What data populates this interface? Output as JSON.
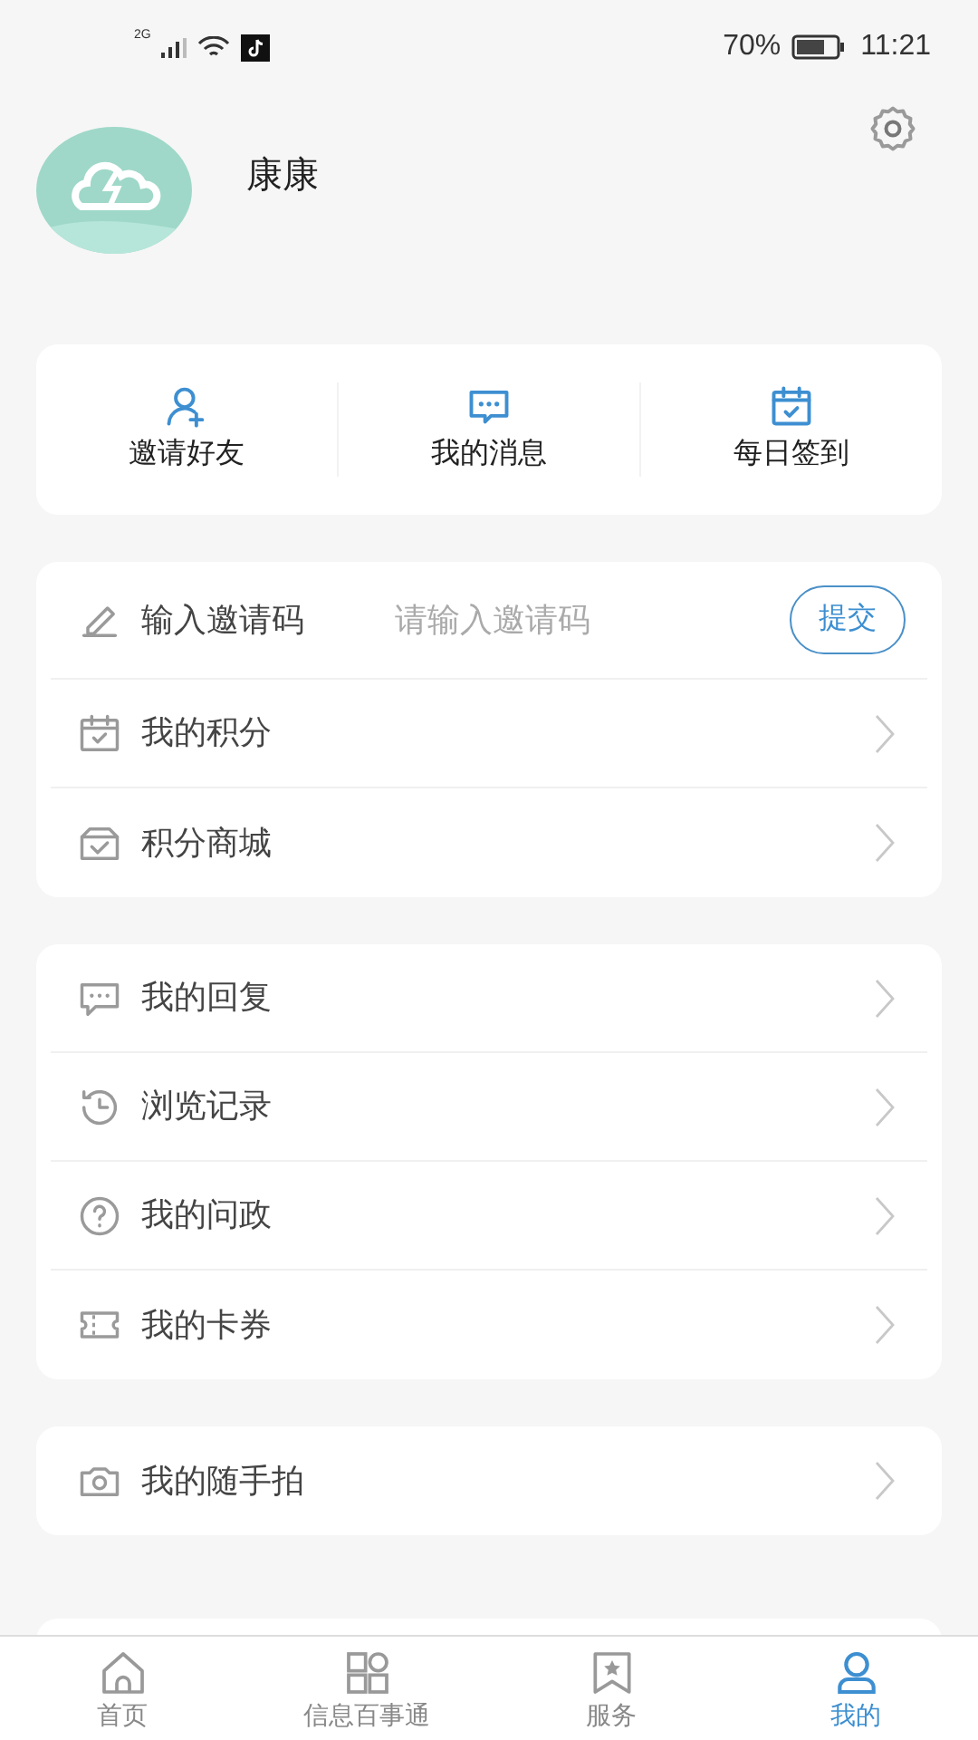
{
  "status_bar": {
    "network": "2G",
    "battery": "70%",
    "time": "11:21"
  },
  "profile": {
    "name": "康康"
  },
  "quick_actions": [
    {
      "label": "邀请好友"
    },
    {
      "label": "我的消息"
    },
    {
      "label": "每日签到"
    }
  ],
  "sections": [
    {
      "items": [
        {
          "kind": "input",
          "label": "输入邀请码",
          "placeholder": "请输入邀请码",
          "button": "提交"
        },
        {
          "kind": "link",
          "label": "我的积分"
        },
        {
          "kind": "link",
          "label": "积分商城"
        }
      ]
    },
    {
      "items": [
        {
          "kind": "link",
          "label": "我的回复"
        },
        {
          "kind": "link",
          "label": "浏览记录"
        },
        {
          "kind": "link",
          "label": "我的问政"
        },
        {
          "kind": "link",
          "label": "我的卡券"
        }
      ]
    },
    {
      "items": [
        {
          "kind": "link",
          "label": "我的随手拍"
        }
      ]
    }
  ],
  "tab_bar": [
    {
      "label": "首页",
      "selected": false
    },
    {
      "label": "信息百事通",
      "selected": false
    },
    {
      "label": "服务",
      "selected": false
    },
    {
      "label": "我的",
      "selected": true
    }
  ]
}
